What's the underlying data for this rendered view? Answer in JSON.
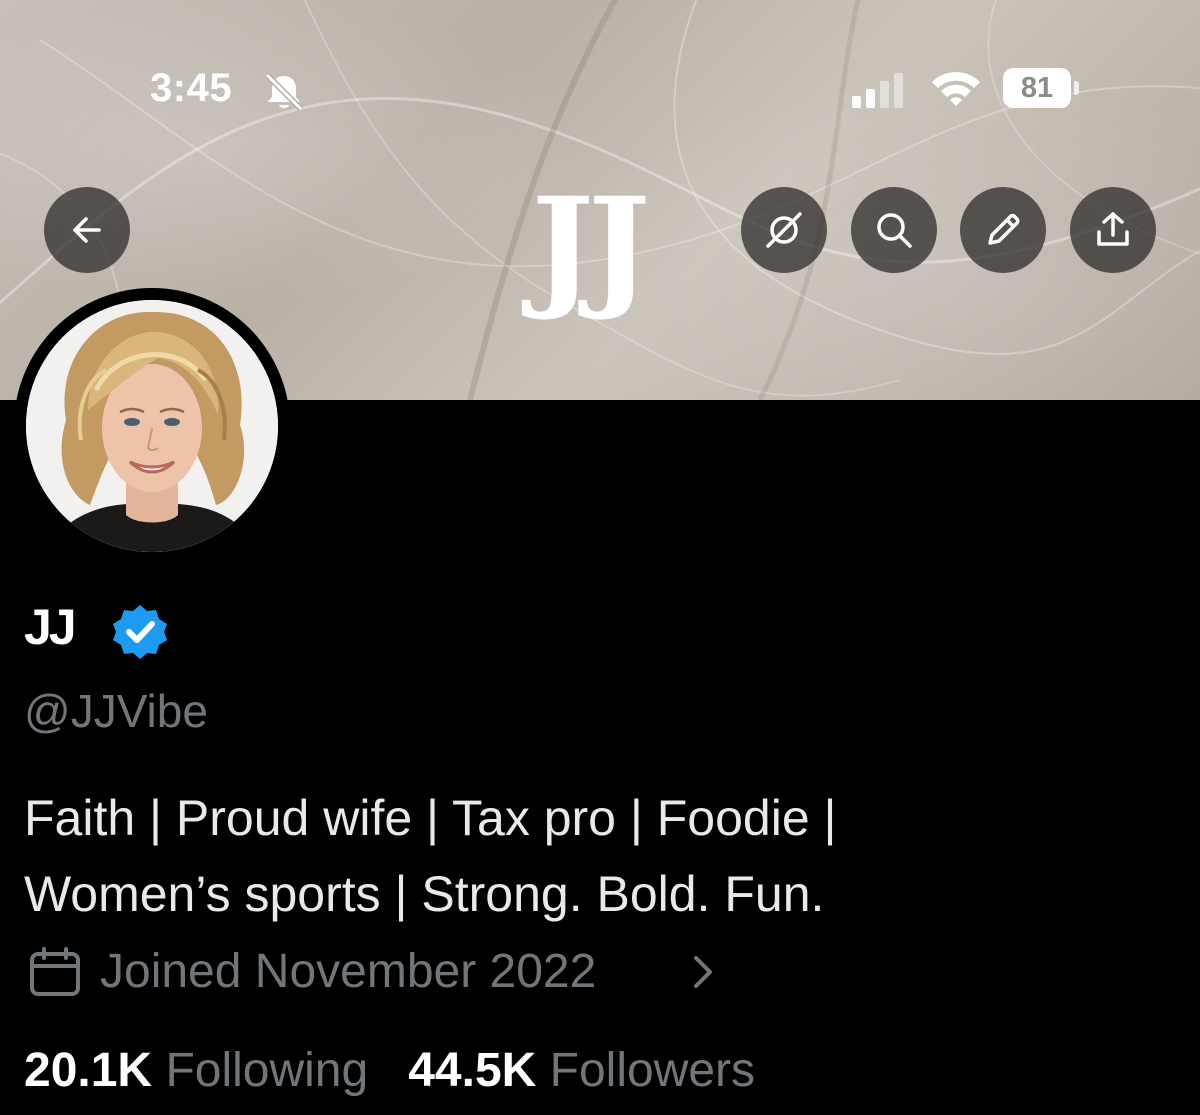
{
  "status_bar": {
    "time": "3:45",
    "battery_level": "81",
    "icons": [
      "bell-slash-icon",
      "cellular-signal-icon",
      "wifi-icon",
      "battery-icon"
    ]
  },
  "header": {
    "banner_logo": "JJ",
    "buttons": [
      {
        "name": "back",
        "icon": "arrow-left-icon"
      },
      {
        "name": "grok",
        "icon": "grok-icon"
      },
      {
        "name": "search",
        "icon": "search-icon"
      },
      {
        "name": "edit",
        "icon": "pencil-icon"
      },
      {
        "name": "share",
        "icon": "share-icon"
      }
    ]
  },
  "profile": {
    "display_name": "JJ",
    "verified": true,
    "verified_color": "#1d9bf0",
    "handle": "@JJVibe",
    "bio_lines": [
      "Faith | Proud wife | Tax pro | Foodie |",
      "Women’s sports | Strong. Bold. Fun."
    ],
    "joined": "Joined November 2022",
    "following_count": "20.1K",
    "following_label": "Following",
    "followers_count": "44.5K",
    "followers_label": "Followers"
  },
  "colors": {
    "background": "#000000",
    "primary_text": "#e7e9ea",
    "secondary_text": "#71767b"
  }
}
